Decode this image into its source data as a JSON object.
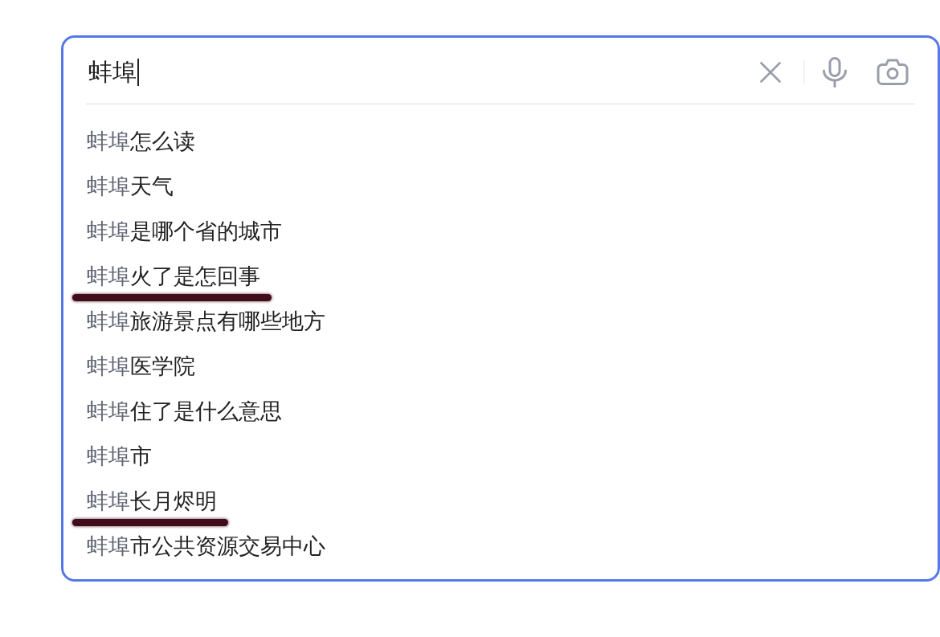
{
  "search": {
    "value": "蚌埠",
    "cursor": true
  },
  "suggestions": [
    {
      "match": "蚌埠",
      "completion": "怎么读",
      "marked": false
    },
    {
      "match": "蚌埠",
      "completion": "天气",
      "marked": false
    },
    {
      "match": "蚌埠",
      "completion": "是哪个省的城市",
      "marked": false
    },
    {
      "match": "蚌埠",
      "completion": "火了是怎回事",
      "marked": true
    },
    {
      "match": "蚌埠",
      "completion": "旅游景点有哪些地方",
      "marked": false
    },
    {
      "match": "蚌埠",
      "completion": "医学院",
      "marked": false
    },
    {
      "match": "蚌埠",
      "completion": "住了是什么意思",
      "marked": false
    },
    {
      "match": "蚌埠",
      "completion": "市",
      "marked": false
    },
    {
      "match": "蚌埠",
      "completion": "长月烬明",
      "marked": true
    },
    {
      "match": "蚌埠",
      "completion": "市公共资源交易中心",
      "marked": false
    }
  ]
}
